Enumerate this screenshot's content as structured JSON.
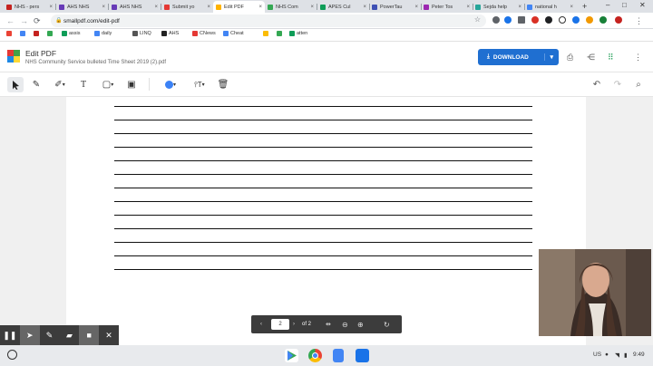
{
  "tabs": [
    {
      "label": "NHS - pers",
      "color": "#c5221f",
      "active": false
    },
    {
      "label": "AHS NHS",
      "color": "#673ab7",
      "active": false
    },
    {
      "label": "AHS NHS",
      "color": "#673ab7",
      "active": false
    },
    {
      "label": "Submit yo",
      "color": "#e53935",
      "active": false
    },
    {
      "label": "Edit PDF",
      "color": "#ffb300",
      "active": true
    },
    {
      "label": "NHS Com",
      "color": "#34a853",
      "active": false
    },
    {
      "label": "APES Cul",
      "color": "#0f9d58",
      "active": false
    },
    {
      "label": "PowerTau",
      "color": "#3f51b5",
      "active": false
    },
    {
      "label": "Peter Tos",
      "color": "#9c27b0",
      "active": false
    },
    {
      "label": "Sejda help",
      "color": "#26a69a",
      "active": false
    },
    {
      "label": "national h",
      "color": "#4285f4",
      "active": false
    }
  ],
  "window": {
    "new_tab": "+",
    "minimize": "–",
    "maximize": "□",
    "close": "✕"
  },
  "address": {
    "url": "smallpdf.com/edit-pdf"
  },
  "bookmarks": [
    {
      "label": "",
      "color": "#ea4335"
    },
    {
      "label": "",
      "color": "#4285f4"
    },
    {
      "label": "",
      "color": "#c5221f"
    },
    {
      "label": "",
      "color": "#34a853"
    },
    {
      "label": "assis",
      "color": "#0f9d58"
    },
    {
      "label": "daily",
      "color": "#4285f4"
    },
    {
      "label": "LINQ",
      "color": "#555555"
    },
    {
      "label": "AHS",
      "color": "#222222"
    },
    {
      "label": "CNews",
      "color": "#e53935"
    },
    {
      "label": "Cheat",
      "color": "#4285f4"
    },
    {
      "label": "",
      "color": "#fbbc04"
    },
    {
      "label": "",
      "color": "#34a853"
    },
    {
      "label": "atten",
      "color": "#0f9d58"
    }
  ],
  "app": {
    "title": "Edit PDF",
    "file_name": "NHS Community Service bulleted Time Sheet 2019 (2).pdf",
    "download_label": "DOWNLOAD",
    "logo_colors": [
      "#e53935",
      "#43a047",
      "#1e88e5",
      "#fdd835"
    ]
  },
  "pager": {
    "current": "2",
    "of_label": "of 2"
  },
  "taskbar": {
    "locale": "US",
    "time": "9:49"
  },
  "colors": {
    "accent": "#1f6fd1",
    "pen_color": "#3b82f6"
  }
}
